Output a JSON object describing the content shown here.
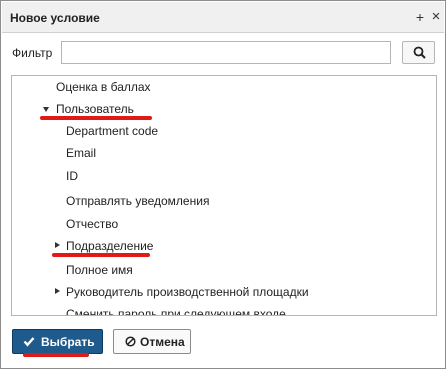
{
  "dialog": {
    "title": "Новое условие",
    "add_glyph": "+",
    "close_glyph": "×"
  },
  "filter": {
    "label": "Фильтр",
    "value": "",
    "placeholder": ""
  },
  "tree": {
    "items": [
      {
        "label": "Оценка в баллах",
        "level": 0,
        "expander": "none"
      },
      {
        "label": "Пользователь",
        "level": 0,
        "expander": "expanded"
      },
      {
        "label": "Department code",
        "level": 1,
        "expander": "none"
      },
      {
        "label": "Email",
        "level": 1,
        "expander": "none"
      },
      {
        "label": "ID",
        "level": 1,
        "expander": "none"
      },
      {
        "label": "Отправлять уведомления",
        "level": 1,
        "expander": "none"
      },
      {
        "label": "Отчество",
        "level": 1,
        "expander": "none"
      },
      {
        "label": "Подразделение",
        "level": 1,
        "expander": "collapsed"
      },
      {
        "label": "Полное имя",
        "level": 1,
        "expander": "none"
      },
      {
        "label": "Руководитель производственной площадки",
        "level": 1,
        "expander": "collapsed"
      },
      {
        "label": "Сменить пароль при следующем входе",
        "level": 1,
        "expander": "none"
      }
    ]
  },
  "footer": {
    "select_label": "Выбрать",
    "cancel_label": "Отмена"
  },
  "colors": {
    "primary": "#1f5a8c",
    "highlight": "#e01919"
  }
}
